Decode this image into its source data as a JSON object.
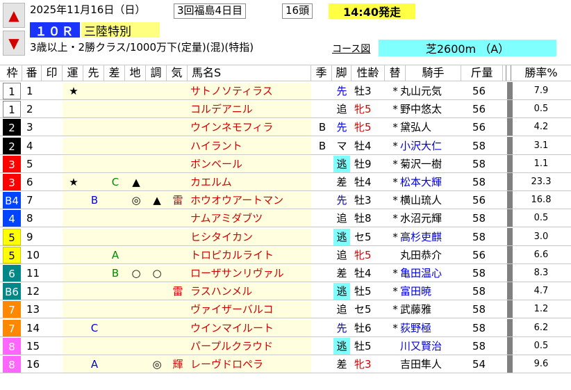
{
  "header": {
    "date": "2025年11月16日（日）",
    "meeting": "3回福島4日目",
    "field_size": "16頭",
    "post_time": "14:40発走",
    "race_number": "１０Ｒ",
    "race_name": "三陸特別",
    "conditions": "3歳以上・2勝クラス/1000万下(定量)(混)(特指)",
    "course_link": "コース図",
    "course": "芝2600m （A）"
  },
  "columns": {
    "waku": "枠",
    "umaban": "番",
    "shirushi": "印",
    "un": "運",
    "saki": "先",
    "sa": "差",
    "chi": "地",
    "cho": "調",
    "ki": "気",
    "name": "馬名S",
    "ki2": "季",
    "kyaku": "脚",
    "seirei": "性齢",
    "kae": "替",
    "kishu": "騎手",
    "kinryo": "斤量",
    "win_rate": "勝率%"
  },
  "colors": {
    "accent_red": "#d40000",
    "row_bg": "#ffffe0",
    "cyan": "#80ffff",
    "yellow": "#ffff44"
  },
  "rows": [
    {
      "waku": "1",
      "umaban": "1",
      "un": "★",
      "saki": "",
      "sa": "",
      "chi": "",
      "cho": "",
      "ki": "",
      "name": "サトノソティラス",
      "ki2": "",
      "kyaku": "先",
      "kyaku_box": false,
      "kyaku_blue": true,
      "sex": "牡3",
      "sex_red": false,
      "kae": "*",
      "jockey": "丸山元気",
      "jockey_blue": false,
      "weight": "56",
      "pct": "7.9"
    },
    {
      "waku": "1",
      "umaban": "2",
      "un": "",
      "saki": "",
      "sa": "",
      "chi": "",
      "cho": "",
      "ki": "",
      "name": "コルデアニル",
      "ki2": "",
      "kyaku": "追",
      "kyaku_box": false,
      "kyaku_blue": false,
      "sex": "牝5",
      "sex_red": true,
      "kae": "*",
      "jockey": "野中悠太",
      "jockey_blue": false,
      "weight": "56",
      "pct": "0.5"
    },
    {
      "waku": "2",
      "umaban": "3",
      "un": "",
      "saki": "",
      "sa": "",
      "chi": "",
      "cho": "",
      "ki": "",
      "name": "ウインネモフィラ",
      "ki2": "B",
      "kyaku": "先",
      "kyaku_box": false,
      "kyaku_blue": true,
      "sex": "牝5",
      "sex_red": true,
      "kae": "*",
      "jockey": "黛弘人",
      "jockey_blue": false,
      "weight": "56",
      "pct": "4.2"
    },
    {
      "waku": "2",
      "umaban": "4",
      "un": "",
      "saki": "",
      "sa": "",
      "chi": "",
      "cho": "",
      "ki": "",
      "name": "ハイラント",
      "ki2": "B",
      "kyaku": "マ",
      "kyaku_box": false,
      "kyaku_blue": false,
      "sex": "牡4",
      "sex_red": false,
      "kae": "*",
      "jockey": "小沢大仁",
      "jockey_blue": true,
      "weight": "58",
      "pct": "3.1"
    },
    {
      "waku": "3",
      "umaban": "5",
      "un": "",
      "saki": "",
      "sa": "",
      "chi": "",
      "cho": "",
      "ki": "",
      "name": "ボンベール",
      "ki2": "",
      "kyaku": "逃",
      "kyaku_box": true,
      "kyaku_blue": false,
      "sex": "牡9",
      "sex_red": false,
      "kae": "*",
      "jockey": "菊沢一樹",
      "jockey_blue": false,
      "weight": "58",
      "pct": "1.1"
    },
    {
      "waku": "3",
      "umaban": "6",
      "un": "★",
      "saki": "",
      "sa": "C",
      "chi": "▲",
      "cho": "",
      "ki": "",
      "name": "カエルム",
      "ki2": "",
      "kyaku": "差",
      "kyaku_box": false,
      "kyaku_blue": false,
      "sex": "牡4",
      "sex_red": false,
      "kae": "*",
      "jockey": "松本大輝",
      "jockey_blue": true,
      "weight": "58",
      "pct": "23.3"
    },
    {
      "waku": "B4",
      "umaban": "7",
      "un": "",
      "saki": "B",
      "sa": "",
      "chi": "◎",
      "cho": "▲",
      "ki": "雷",
      "name": "ホウオウアートマン",
      "ki2": "",
      "kyaku": "先",
      "kyaku_box": false,
      "kyaku_blue": true,
      "sex": "牡3",
      "sex_red": false,
      "kae": "*",
      "jockey": "横山琉人",
      "jockey_blue": false,
      "weight": "56",
      "pct": "16.8"
    },
    {
      "waku": "4",
      "umaban": "8",
      "un": "",
      "saki": "",
      "sa": "",
      "chi": "",
      "cho": "",
      "ki": "",
      "name": "ナムアミダブツ",
      "ki2": "",
      "kyaku": "追",
      "kyaku_box": false,
      "kyaku_blue": false,
      "sex": "牡8",
      "sex_red": false,
      "kae": "*",
      "jockey": "水沼元輝",
      "jockey_blue": false,
      "weight": "58",
      "pct": "0.5"
    },
    {
      "waku": "5",
      "umaban": "9",
      "un": "",
      "saki": "",
      "sa": "",
      "chi": "",
      "cho": "",
      "ki": "",
      "name": "ヒシタイカン",
      "ki2": "",
      "kyaku": "逃",
      "kyaku_box": true,
      "kyaku_blue": false,
      "sex": "セ5",
      "sex_red": false,
      "kae": "*",
      "jockey": "高杉吏麒",
      "jockey_blue": true,
      "weight": "58",
      "pct": "3.0"
    },
    {
      "waku": "5",
      "umaban": "10",
      "un": "",
      "saki": "",
      "sa": "A",
      "chi": "",
      "cho": "",
      "ki": "",
      "name": "トロピカルライト",
      "ki2": "",
      "kyaku": "追",
      "kyaku_box": false,
      "kyaku_blue": false,
      "sex": "牝5",
      "sex_red": true,
      "kae": "",
      "jockey": "丸田恭介",
      "jockey_blue": false,
      "weight": "56",
      "pct": "6.6"
    },
    {
      "waku": "6",
      "umaban": "11",
      "un": "",
      "saki": "",
      "sa": "B",
      "chi": "○",
      "cho": "○",
      "ki": "",
      "name": "ローザサンリヴァル",
      "ki2": "",
      "kyaku": "差",
      "kyaku_box": false,
      "kyaku_blue": false,
      "sex": "牡4",
      "sex_red": false,
      "kae": "*",
      "jockey": "亀田温心",
      "jockey_blue": true,
      "weight": "58",
      "pct": "8.3"
    },
    {
      "waku": "B6",
      "umaban": "12",
      "un": "",
      "saki": "",
      "sa": "",
      "chi": "",
      "cho": "",
      "ki": "雷",
      "name": "ラスハンメル",
      "ki2": "",
      "kyaku": "逃",
      "kyaku_box": true,
      "kyaku_blue": false,
      "sex": "牡5",
      "sex_red": false,
      "kae": "*",
      "jockey": "富田暁",
      "jockey_blue": true,
      "weight": "58",
      "pct": "4.7"
    },
    {
      "waku": "7",
      "umaban": "13",
      "un": "",
      "saki": "",
      "sa": "",
      "chi": "",
      "cho": "",
      "ki": "",
      "name": "ヴァイザーバルコ",
      "ki2": "",
      "kyaku": "追",
      "kyaku_box": false,
      "kyaku_blue": false,
      "sex": "セ5",
      "sex_red": false,
      "kae": "*",
      "jockey": "武藤雅",
      "jockey_blue": false,
      "weight": "58",
      "pct": "1.2"
    },
    {
      "waku": "7",
      "umaban": "14",
      "un": "",
      "saki": "C",
      "sa": "",
      "chi": "",
      "cho": "",
      "ki": "",
      "name": "ウインマイルート",
      "ki2": "",
      "kyaku": "先",
      "kyaku_box": false,
      "kyaku_blue": true,
      "sex": "牡6",
      "sex_red": false,
      "kae": "*",
      "jockey": "荻野極",
      "jockey_blue": true,
      "weight": "58",
      "pct": "6.2"
    },
    {
      "waku": "8",
      "umaban": "15",
      "un": "",
      "saki": "",
      "sa": "",
      "chi": "",
      "cho": "",
      "ki": "",
      "name": "パープルクラウド",
      "ki2": "",
      "kyaku": "逃",
      "kyaku_box": true,
      "kyaku_blue": false,
      "sex": "牡5",
      "sex_red": false,
      "kae": "",
      "jockey": "川又賢治",
      "jockey_blue": true,
      "weight": "58",
      "pct": "0.5"
    },
    {
      "waku": "8",
      "umaban": "16",
      "un": "",
      "saki": "A",
      "sa": "",
      "chi": "",
      "cho": "◎",
      "ki": "輝",
      "name": "レーヴドロペラ",
      "ki2": "",
      "kyaku": "差",
      "kyaku_box": false,
      "kyaku_blue": false,
      "sex": "牝3",
      "sex_red": true,
      "kae": "",
      "jockey": "吉田隼人",
      "jockey_blue": false,
      "weight": "54",
      "pct": "9.6"
    }
  ]
}
